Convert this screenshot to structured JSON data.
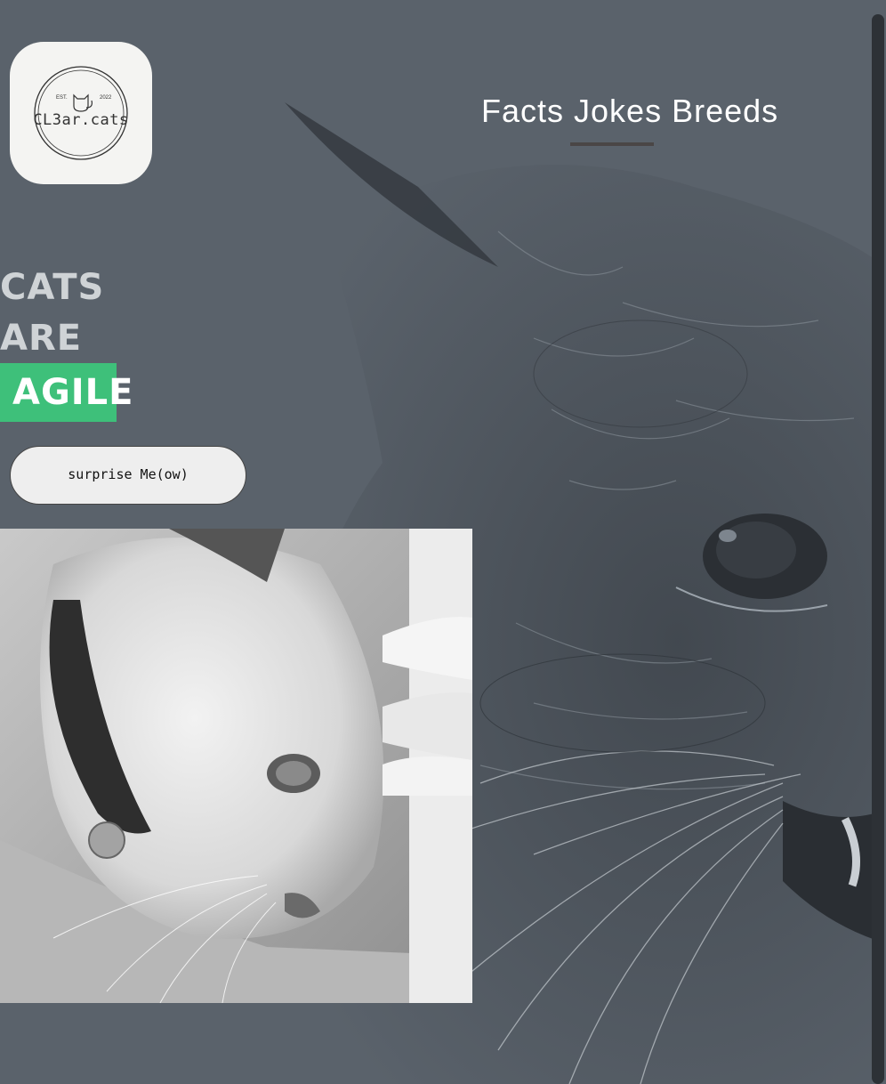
{
  "logo": {
    "text": "CL3ar.cats",
    "est": "EST.",
    "year": "2022"
  },
  "nav": {
    "items": [
      "Facts",
      "Jokes",
      "Breeds"
    ]
  },
  "headline": {
    "line1": "CATS",
    "line2": "ARE",
    "highlight": "AGILE"
  },
  "button": {
    "label": "surprise Me(ow)"
  },
  "colors": {
    "background": "#5a626b",
    "accent": "#3ec07a",
    "logo_bg": "#f4f4f2"
  }
}
